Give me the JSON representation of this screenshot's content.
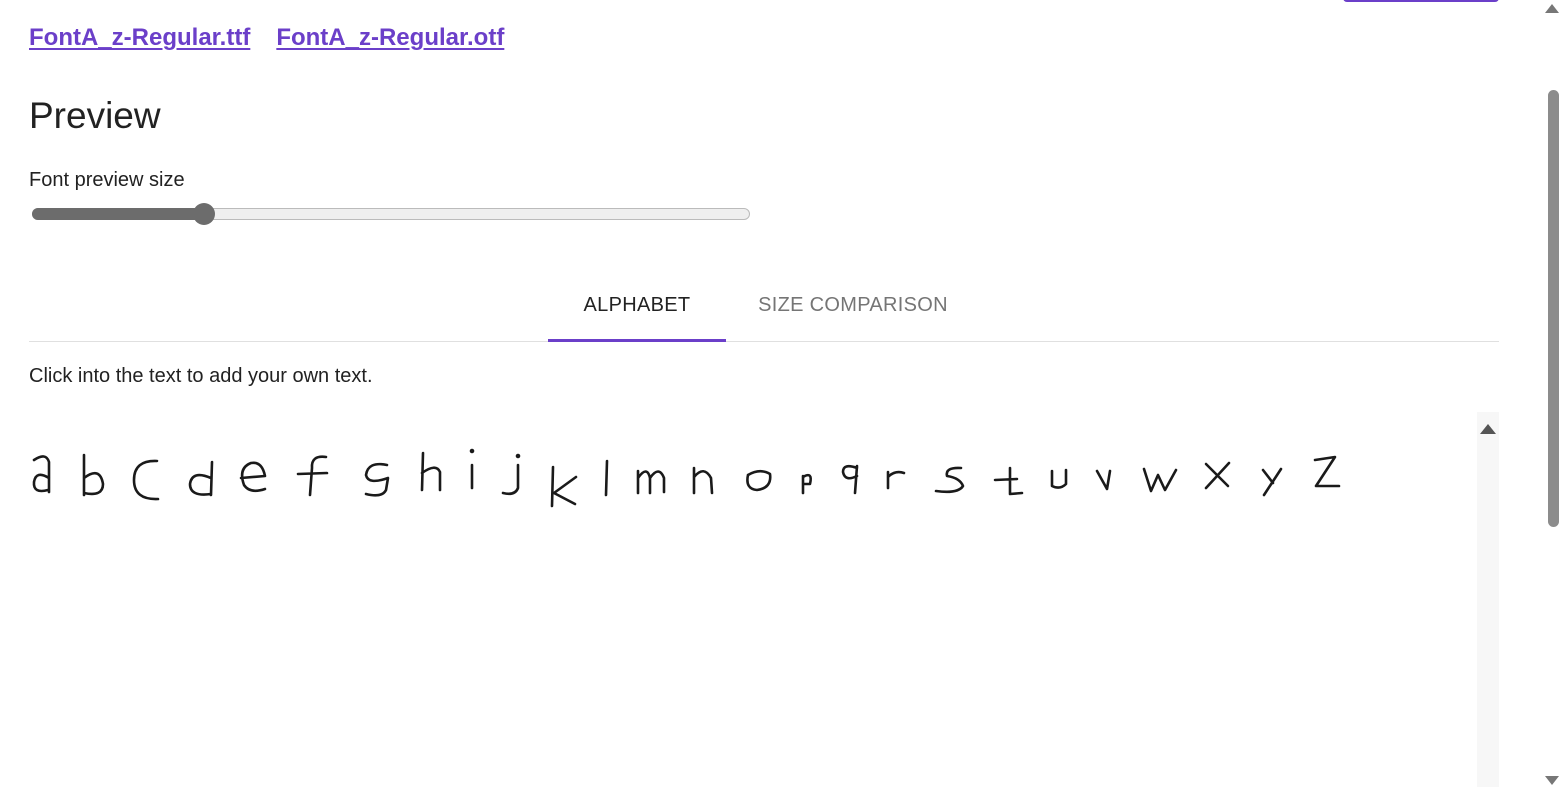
{
  "downloads": [
    {
      "label": "FontA_z-Regular.ttf"
    },
    {
      "label": "FontA_z-Regular.otf"
    }
  ],
  "preview": {
    "heading": "Preview",
    "size_label": "Font preview size",
    "size_slider_fraction": 0.24
  },
  "tabs": [
    {
      "label": "ALPHABET",
      "active": true
    },
    {
      "label": "SIZE COMPARISON",
      "active": false
    }
  ],
  "hint": "Click into the text to add your own text.",
  "alphabet_sample": "a b c d e f g h i j k l m n o p q r s t u v w x y z",
  "colors": {
    "accent": "#6b3fc9",
    "slider": "#6c6c6c"
  }
}
